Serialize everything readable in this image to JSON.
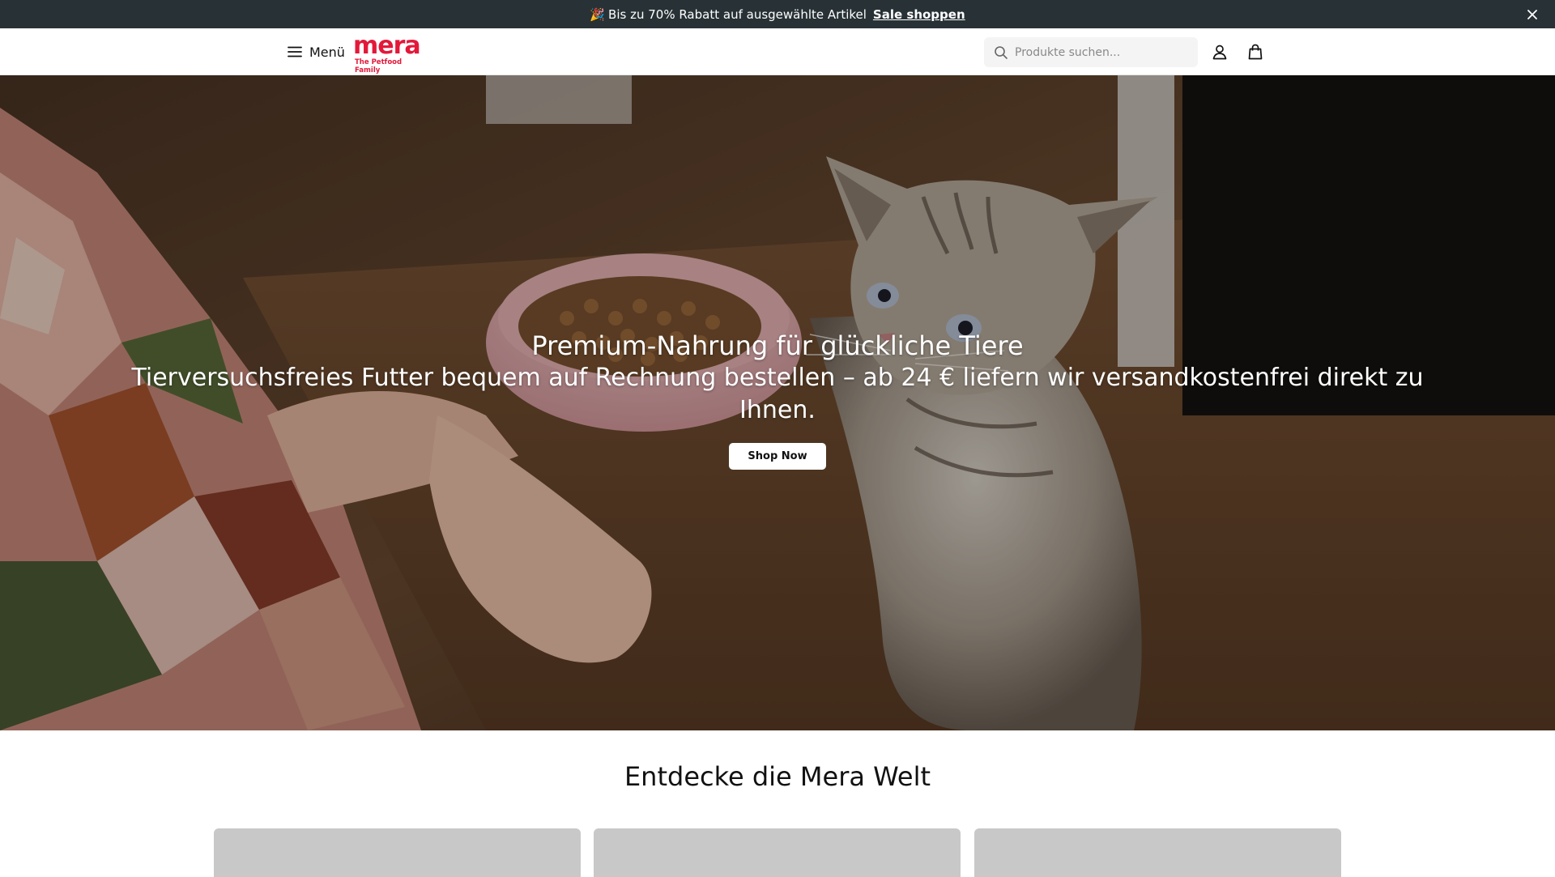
{
  "announcement": {
    "emoji": "🎉",
    "text": "Bis zu 70% Rabatt auf ausgewählte Artikel",
    "link_label": "Sale shoppen",
    "close_icon": "close-icon"
  },
  "header": {
    "menu_label": "Menü",
    "menu_icon": "hamburger-icon",
    "logo": {
      "word": "mera",
      "tagline": "The Petfood Family"
    },
    "search": {
      "placeholder": "Produkte suchen...",
      "value": "",
      "icon": "search-icon"
    },
    "account_icon": "user-icon",
    "cart_icon": "shopping-bag-icon"
  },
  "hero": {
    "title": "Premium-Nahrung für glückliche Tiere",
    "subtitle": "Tierversuchsfreies Futter bequem auf Rechnung bestellen – ab 24 € liefern wir versandkostenfrei direkt zu Ihnen.",
    "cta_label": "Shop Now",
    "image_subject": "cat-looking-at-food-bowl"
  },
  "discover": {
    "title": "Entdecke die Mera Welt",
    "cards": [
      "card-1",
      "card-2",
      "card-3"
    ]
  },
  "colors": {
    "brand": "#e3193a",
    "announcement_bg": "#283236",
    "search_bg": "#f4f4f5",
    "card_placeholder": "#c8c8c8"
  }
}
